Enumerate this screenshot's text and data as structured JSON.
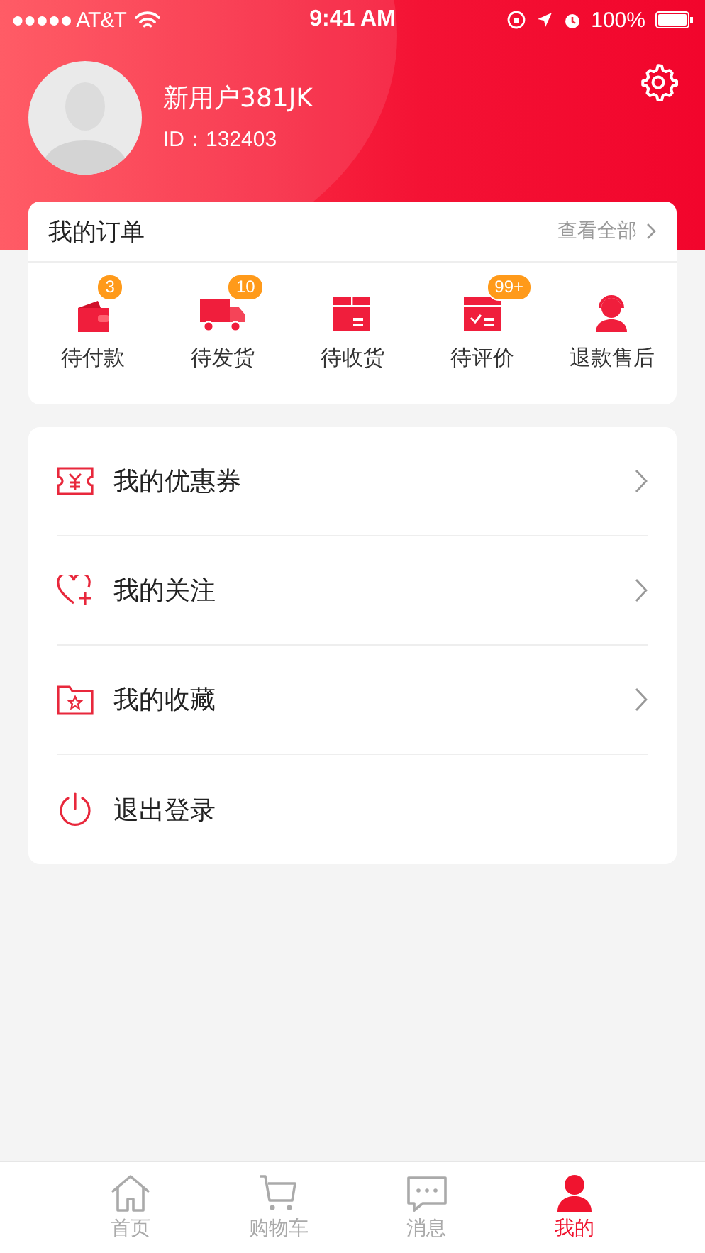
{
  "status_bar": {
    "carrier": "●●●●● AT&T",
    "time": "9:41 AM",
    "battery": "100%"
  },
  "profile": {
    "username": "新用户381JK",
    "user_id": "ID：132403"
  },
  "orders": {
    "title": "我的订单",
    "view_all": "查看全部",
    "items": [
      {
        "kind": "wallet",
        "label": "待付款",
        "badge": "3"
      },
      {
        "kind": "truck",
        "label": "待发货",
        "badge": "10"
      },
      {
        "kind": "box",
        "label": "待收货"
      },
      {
        "kind": "review",
        "label": "待评价",
        "badge": "99+"
      },
      {
        "kind": "service",
        "label": "退款售后"
      }
    ]
  },
  "menu": [
    {
      "kind": "coupon",
      "label": "我的优惠券",
      "arrow": true
    },
    {
      "kind": "heart",
      "label": "我的关注",
      "arrow": true
    },
    {
      "kind": "folder",
      "label": "我的收藏",
      "arrow": true
    },
    {
      "kind": "power",
      "label": "退出登录",
      "arrow": false
    }
  ],
  "tab_bar": [
    {
      "kind": "home",
      "label": "首页",
      "selected": false
    },
    {
      "kind": "cart",
      "label": "购物车",
      "selected": false
    },
    {
      "kind": "message",
      "label": "消息",
      "selected": false
    },
    {
      "kind": "person",
      "label": "我的",
      "selected": true
    }
  ]
}
